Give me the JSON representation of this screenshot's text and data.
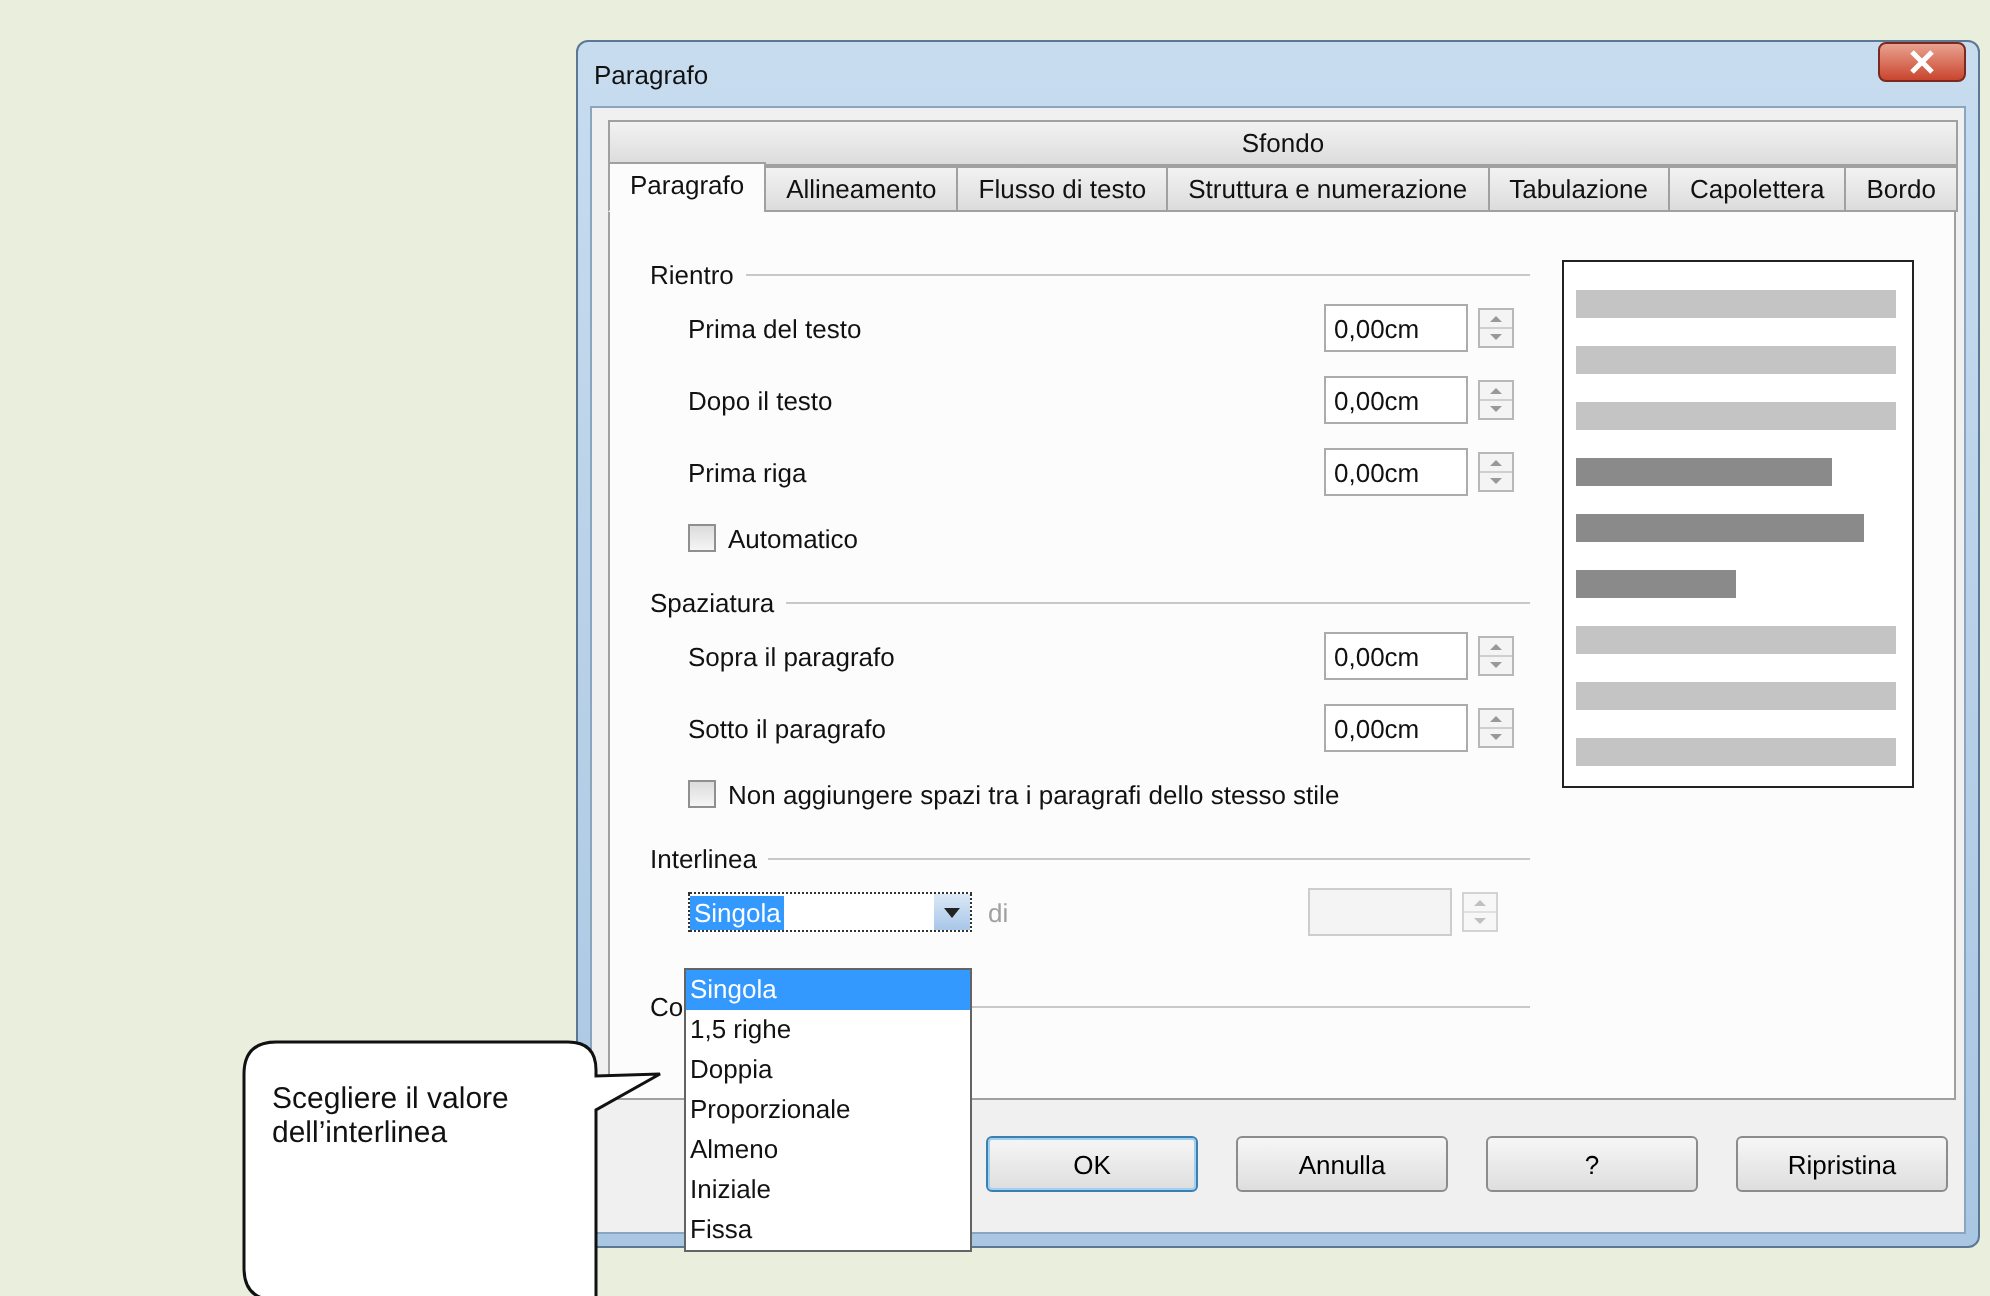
{
  "window": {
    "title": "Paragrafo"
  },
  "tab_rows": [
    [
      {
        "label": "Sfondo",
        "selected": false
      }
    ],
    [
      {
        "label": "Paragrafo",
        "selected": true
      },
      {
        "label": "Allineamento",
        "selected": false
      },
      {
        "label": "Flusso di testo",
        "selected": false
      },
      {
        "label": "Struttura e numerazione",
        "selected": false
      },
      {
        "label": "Tabulazione",
        "selected": false
      },
      {
        "label": "Capolettera",
        "selected": false
      },
      {
        "label": "Bordo",
        "selected": false
      }
    ]
  ],
  "sections": [
    {
      "title": "Rientro",
      "items": [
        {
          "kind": "spin",
          "label": "Prima del testo",
          "value": "0,00cm",
          "disabled": false
        },
        {
          "kind": "spin",
          "label": "Dopo il testo",
          "value": "0,00cm",
          "disabled": false
        },
        {
          "kind": "spin",
          "label": "Prima riga",
          "value": "0,00cm",
          "disabled": false
        },
        {
          "kind": "check",
          "label": "Automatico",
          "checked": false
        }
      ]
    },
    {
      "title": "Spaziatura",
      "items": [
        {
          "kind": "spin",
          "label": "Sopra il paragrafo",
          "value": "0,00cm",
          "disabled": false
        },
        {
          "kind": "spin",
          "label": "Sotto il paragrafo",
          "value": "0,00cm",
          "disabled": false
        },
        {
          "kind": "check",
          "label": "Non aggiungere spazi tra i paragrafi dello stesso stile",
          "checked": false
        }
      ]
    },
    {
      "title": "Interlinea",
      "items": [
        {
          "kind": "combo",
          "value": "Singola",
          "label": "di",
          "disabled": true
        }
      ]
    },
    {
      "title": "Co"
    }
  ],
  "dropdown": {
    "options": [
      {
        "label": "Singola",
        "selected": true
      },
      {
        "label": "1,5 righe",
        "selected": false
      },
      {
        "label": "Doppia",
        "selected": false
      },
      {
        "label": "Proporzionale",
        "selected": false
      },
      {
        "label": "Almeno",
        "selected": false
      },
      {
        "label": "Iniziale",
        "selected": false
      },
      {
        "label": "Fissa",
        "selected": false
      }
    ]
  },
  "buttons": [
    {
      "label": "OK",
      "default": true
    },
    {
      "label": "Annulla",
      "default": false
    },
    {
      "label": "?",
      "default": false
    },
    {
      "label": "Ripristina",
      "default": false
    }
  ],
  "callout": {
    "text": "Scegliere il valore dell’interlinea"
  }
}
